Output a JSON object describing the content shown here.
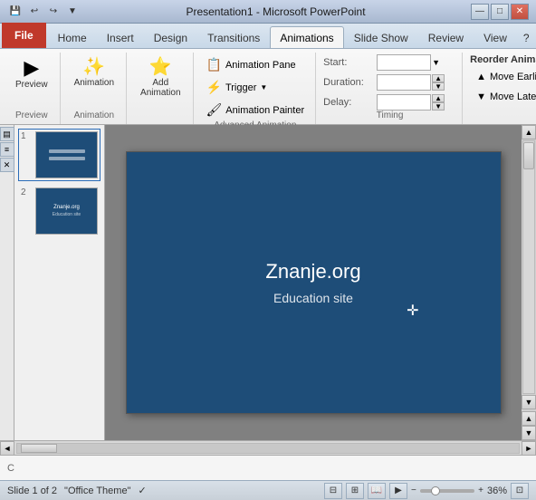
{
  "titlebar": {
    "title": "Presentation1 - Microsoft PowerPoint",
    "quick_access": [
      "💾",
      "🖨",
      "↩",
      "↪",
      "▼"
    ]
  },
  "ribbon": {
    "tabs": [
      {
        "id": "file",
        "label": "File",
        "active": false,
        "is_file": true
      },
      {
        "id": "home",
        "label": "Home",
        "active": false
      },
      {
        "id": "insert",
        "label": "Insert",
        "active": false
      },
      {
        "id": "design",
        "label": "Design",
        "active": false
      },
      {
        "id": "transitions",
        "label": "Transitions",
        "active": false
      },
      {
        "id": "animations",
        "label": "Animations",
        "active": true
      },
      {
        "id": "slideshow",
        "label": "Slide Show",
        "active": false
      },
      {
        "id": "review",
        "label": "Review",
        "active": false
      },
      {
        "id": "view",
        "label": "View",
        "active": false
      }
    ],
    "groups": {
      "preview": {
        "label": "Preview",
        "preview_btn": "Preview"
      },
      "animation": {
        "label": "Animation",
        "btn": "Animation"
      },
      "add_animation": {
        "label": "",
        "btn": "Add\nAnimation"
      },
      "advanced_animation": {
        "label": "Advanced Animation",
        "animation_pane": "Animation Pane",
        "trigger": "Trigger",
        "animation_painter": "Animation Painter"
      },
      "timing": {
        "label": "Timing",
        "start_label": "Start:",
        "start_value": "",
        "duration_label": "Duration:",
        "duration_value": "",
        "delay_label": "Delay:",
        "delay_value": ""
      },
      "reorder": {
        "title": "Reorder Animation",
        "move_earlier": "Move Earlier",
        "move_later": "Move Later"
      }
    }
  },
  "slide_panel": {
    "slides": [
      {
        "num": "1",
        "active": true
      },
      {
        "num": "2",
        "active": false
      }
    ]
  },
  "slide": {
    "title": "Znanje.org",
    "subtitle": "Education site"
  },
  "status_bar": {
    "slide_info": "Slide 1 of 2",
    "theme": "\"Office Theme\"",
    "zoom": "36%"
  },
  "notes": {
    "label": "C"
  }
}
